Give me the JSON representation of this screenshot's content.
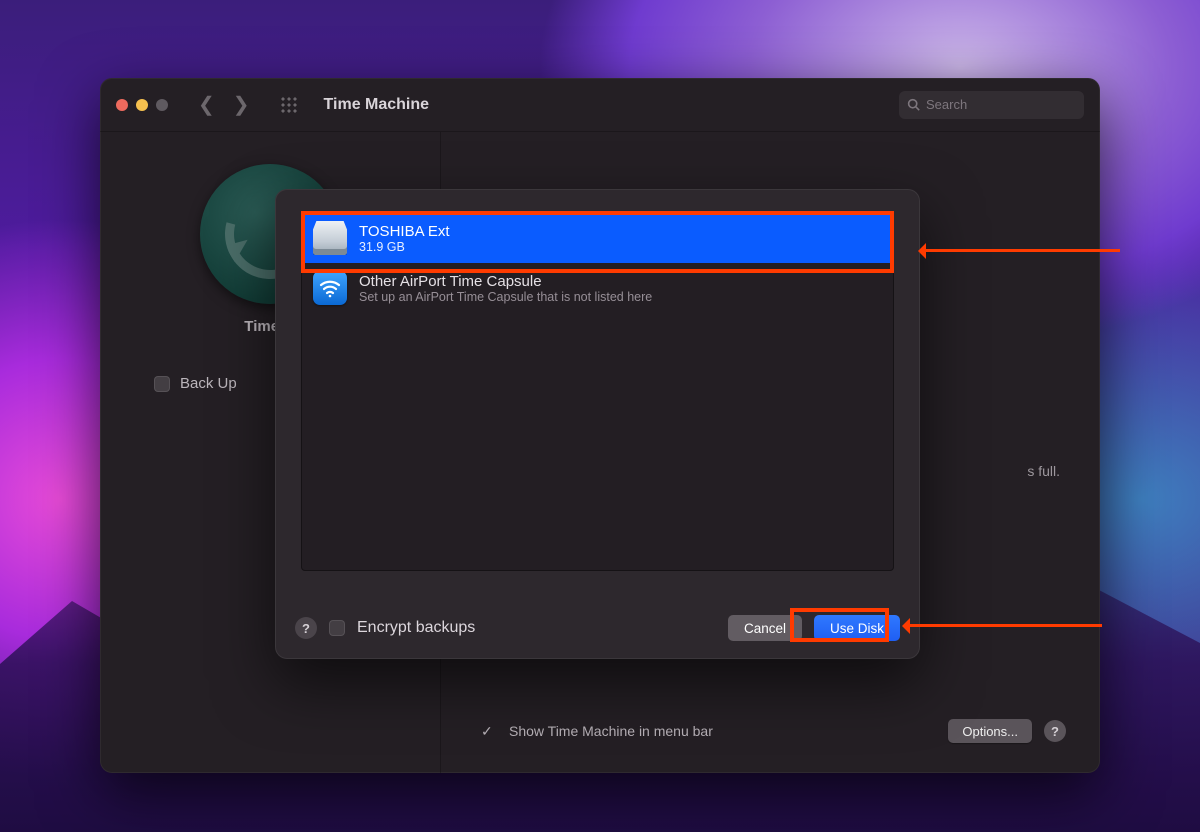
{
  "window": {
    "title": "Time Machine",
    "search_placeholder": "Search"
  },
  "left": {
    "app_label": "Time M",
    "backup_auto_label": "Back Up"
  },
  "right": {
    "full_suffix": "s full.",
    "show_in_menubar": "Show Time Machine in menu bar",
    "options_button": "Options..."
  },
  "sheet": {
    "disks": [
      {
        "name": "TOSHIBA Ext",
        "sub": "31.9 GB",
        "selected": true,
        "kind": "disk"
      },
      {
        "name": "Other AirPort Time Capsule",
        "sub": "Set up an AirPort Time Capsule that is not listed here",
        "selected": false,
        "kind": "airport"
      }
    ],
    "encrypt_label": "Encrypt backups",
    "cancel_label": "Cancel",
    "use_disk_label": "Use Disk"
  }
}
